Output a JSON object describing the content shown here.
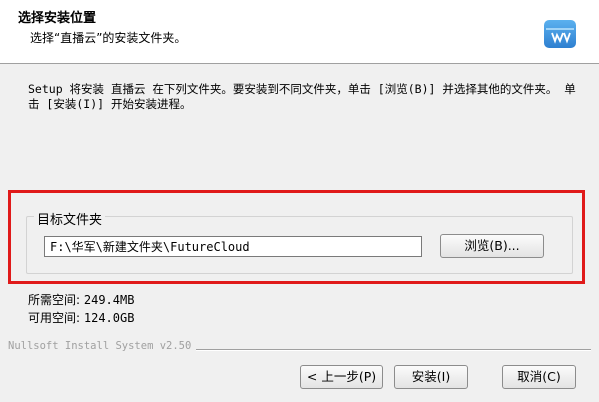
{
  "header": {
    "title": "选择安装位置",
    "subtitle": "选择“直播云”的安装文件夹。",
    "app_icon": "futurecloud-box-icon"
  },
  "description": "Setup 将安装 直播云 在下列文件夹。要安装到不同文件夹，单击 [浏览(B)] 并选择其他的文件夹。 单击 [安装(I)] 开始安装进程。",
  "destination": {
    "group_label": "目标文件夹",
    "path": "F:\\华军\\新建文件夹\\FutureCloud",
    "browse_label": "浏览(B)..."
  },
  "space": {
    "required_label": "所需空间:",
    "required_value": "249.4MB",
    "available_label": "可用空间:",
    "available_value": "124.0GB"
  },
  "footer": {
    "branding": "Nullsoft Install System v2.50",
    "back_label": "< 上一步(P)",
    "install_label": "安装(I)",
    "cancel_label": "取消(C)"
  },
  "colors": {
    "highlight": "#e01a1a",
    "window_bg": "#f0f0f0",
    "header_bg": "#ffffff"
  }
}
